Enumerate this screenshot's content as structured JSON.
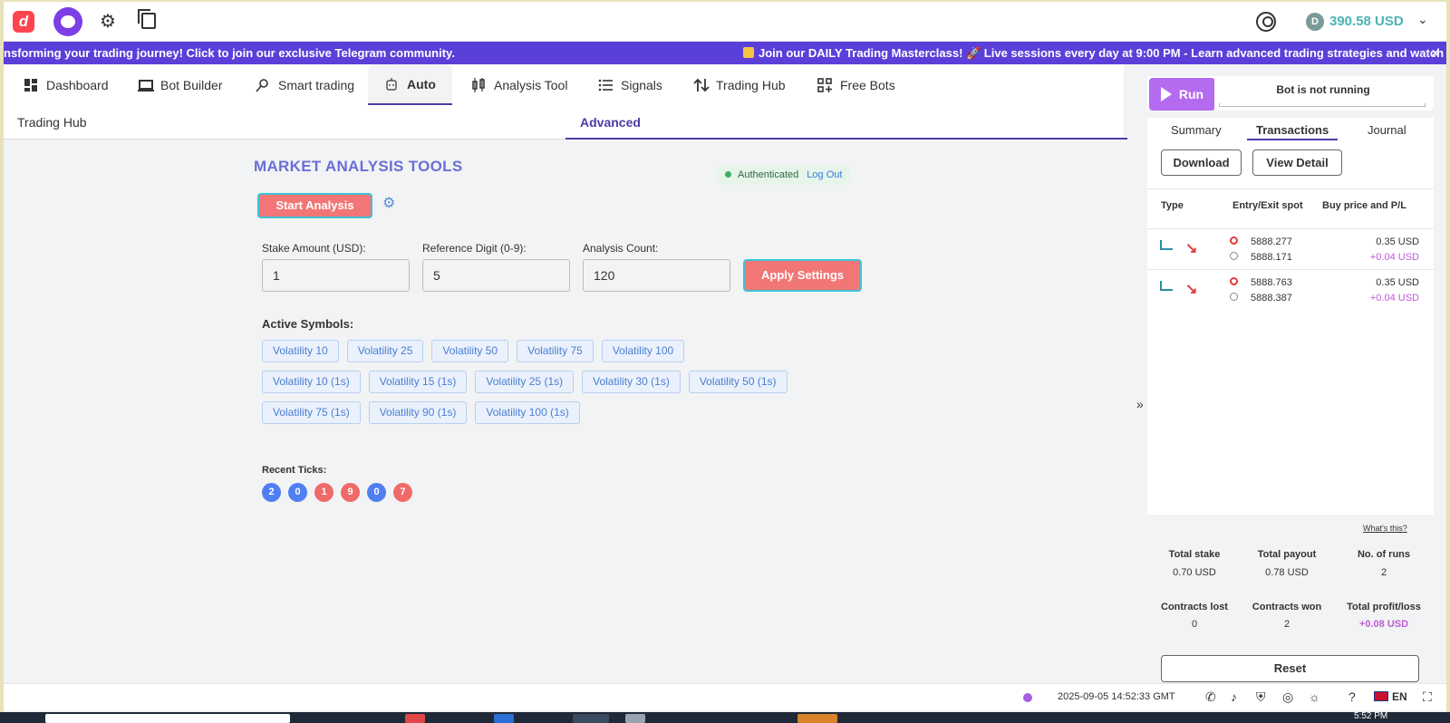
{
  "topbar": {
    "logo": "d",
    "balance": "390.58 USD",
    "currency_glyph": "D"
  },
  "banner": {
    "text_left": "nsforming your trading journey! Click to join our exclusive Telegram community.",
    "text_right": "Join our DAILY Trading Masterclass! 🚀 Live sessions every day at 9:00 PM - Learn advanced trading strategies and watch real-time",
    "close": "×"
  },
  "nav": {
    "tabs": [
      {
        "label": "Dashboard",
        "icon": "dashboard-icon"
      },
      {
        "label": "Bot Builder",
        "icon": "bot-builder-icon"
      },
      {
        "label": "Smart trading",
        "icon": "smart-trading-icon"
      },
      {
        "label": "Auto",
        "icon": "robot-icon",
        "active": true
      },
      {
        "label": "Analysis Tool",
        "icon": "analysis-icon"
      },
      {
        "label": "Signals",
        "icon": "list-icon"
      },
      {
        "label": "Trading Hub",
        "icon": "swap-icon"
      },
      {
        "label": "Free Bots",
        "icon": "grid-icon"
      }
    ]
  },
  "subtabs": {
    "left": "Trading Hub",
    "right": "Advanced"
  },
  "analysis": {
    "title": "MARKET ANALYSIS TOOLS",
    "auth_status": "Authenticated",
    "logout": "Log Out",
    "start_button": "Start Analysis",
    "fields": [
      {
        "label": "Stake Amount (USD):",
        "value": "1"
      },
      {
        "label": "Reference Digit (0-9):",
        "value": "5"
      },
      {
        "label": "Analysis Count:",
        "value": "120"
      }
    ],
    "apply_button": "Apply Settings",
    "active_symbols_label": "Active Symbols:",
    "symbols": [
      "Volatility 10",
      "Volatility 25",
      "Volatility 50",
      "Volatility 75",
      "Volatility 100",
      "Volatility 10 (1s)",
      "Volatility 15 (1s)",
      "Volatility 25 (1s)",
      "Volatility 30 (1s)",
      "Volatility 50 (1s)",
      "Volatility 75 (1s)",
      "Volatility 90 (1s)",
      "Volatility 100 (1s)"
    ],
    "recent_ticks_label": "Recent Ticks:",
    "ticks": [
      {
        "digit": "2",
        "color": "#4f7ff0"
      },
      {
        "digit": "0",
        "color": "#4f7ff0"
      },
      {
        "digit": "1",
        "color": "#f06a6a"
      },
      {
        "digit": "9",
        "color": "#f06a6a"
      },
      {
        "digit": "0",
        "color": "#4f7ff0"
      },
      {
        "digit": "7",
        "color": "#f06a6a"
      }
    ]
  },
  "run_panel": {
    "run_button": "Run",
    "status": "Bot is not running",
    "tabs": [
      "Summary",
      "Transactions",
      "Journal"
    ],
    "active_tab": "Transactions",
    "download": "Download",
    "view_detail": "View Detail",
    "headers": [
      "Type",
      "Entry/Exit spot",
      "Buy price and P/L"
    ],
    "transactions": [
      {
        "entry": "5888.277",
        "exit": "5888.171",
        "buy": "0.35 USD",
        "pl": "+0.04 USD"
      },
      {
        "entry": "5888.763",
        "exit": "5888.387",
        "buy": "0.35 USD",
        "pl": "+0.04 USD"
      }
    ],
    "whats_this": "What's this?",
    "stats": [
      {
        "label": "Total stake",
        "value": "0.70 USD"
      },
      {
        "label": "Total payout",
        "value": "0.78 USD"
      },
      {
        "label": "No. of runs",
        "value": "2"
      },
      {
        "label": "Contracts lost",
        "value": "0"
      },
      {
        "label": "Contracts won",
        "value": "2"
      },
      {
        "label": "Total profit/loss",
        "value": "+0.08 USD"
      }
    ],
    "reset": "Reset"
  },
  "footer": {
    "timestamp": "2025-09-05 14:52:33 GMT",
    "language": "EN"
  },
  "taskbar": {
    "time": "5:52 PM"
  }
}
